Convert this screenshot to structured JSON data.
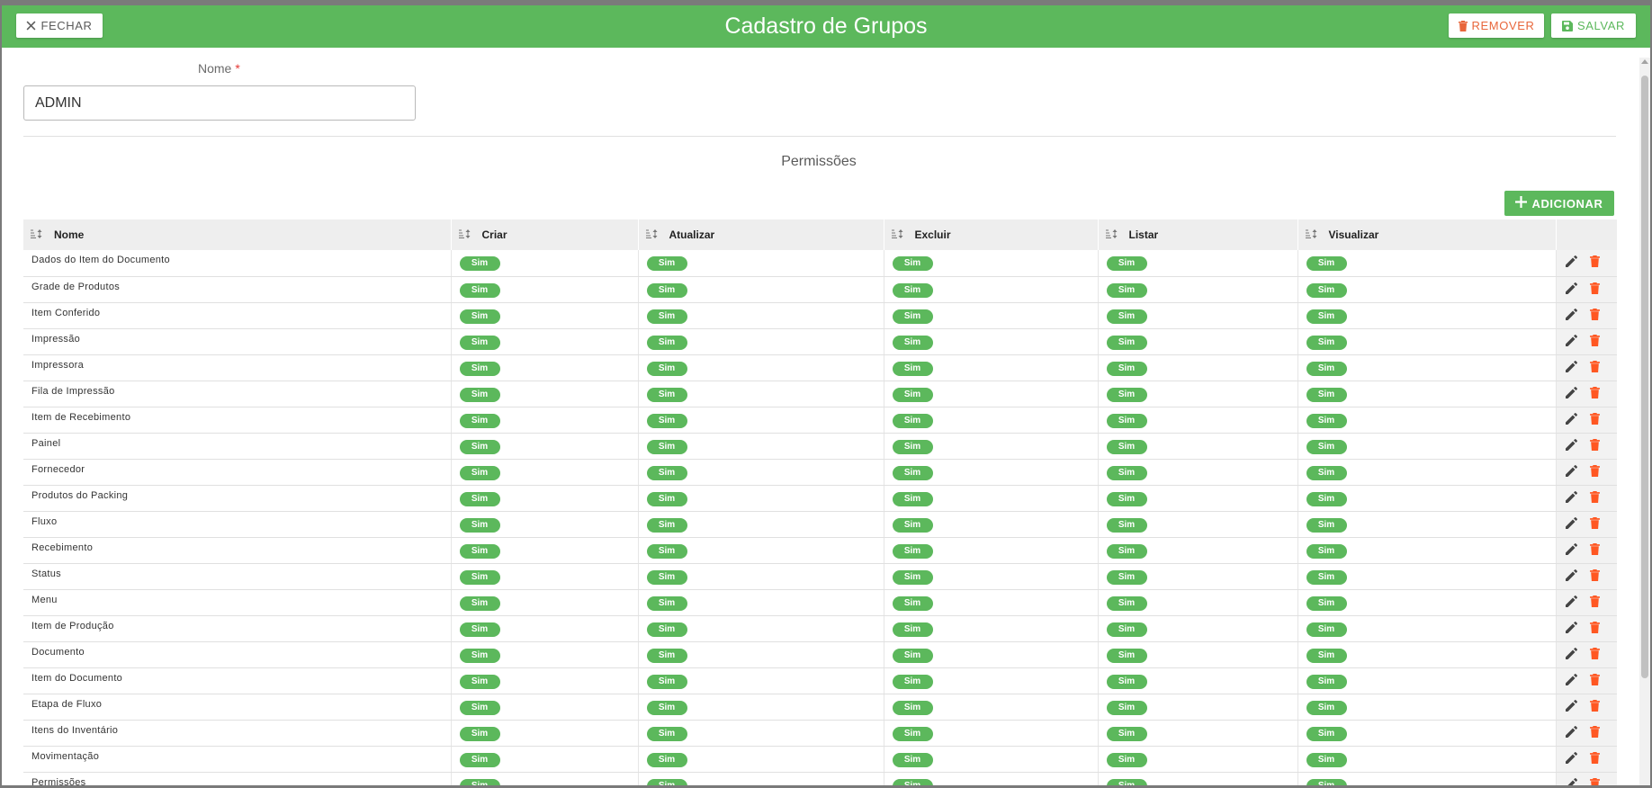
{
  "header": {
    "title": "Cadastro de Grupos",
    "close_label": "FECHAR",
    "remove_label": "REMOVER",
    "save_label": "SALVAR"
  },
  "form": {
    "name_label": "Nome",
    "required_mark": "*",
    "name_value": "ADMIN"
  },
  "permissions": {
    "title": "Permissões",
    "add_label": "ADICIONAR",
    "columns": [
      "Nome",
      "Criar",
      "Atualizar",
      "Excluir",
      "Listar",
      "Visualizar"
    ],
    "badge_label": "Sim",
    "rows": [
      "Dados do Item do Documento",
      "Grade de Produtos",
      "Item Conferido",
      "Impressão",
      "Impressora",
      "Fila de Impressão",
      "Item de Recebimento",
      "Painel",
      "Fornecedor",
      "Produtos do Packing",
      "Fluxo",
      "Recebimento",
      "Status",
      "Menu",
      "Item de Produção",
      "Documento",
      "Item do Documento",
      "Etapa de Fluxo",
      "Itens do Inventário",
      "Movimentação",
      "Permissões"
    ]
  },
  "colors": {
    "primary": "#5cb85c",
    "danger": "#e8663b",
    "edit_icon": "#444444",
    "delete_icon": "#ff5722"
  },
  "icons": {
    "close": "close-icon",
    "remove": "trash-icon",
    "save": "save-icon",
    "add": "plus-icon",
    "sort": "sort-icon",
    "edit": "pencil-icon",
    "delete": "trash-icon"
  }
}
